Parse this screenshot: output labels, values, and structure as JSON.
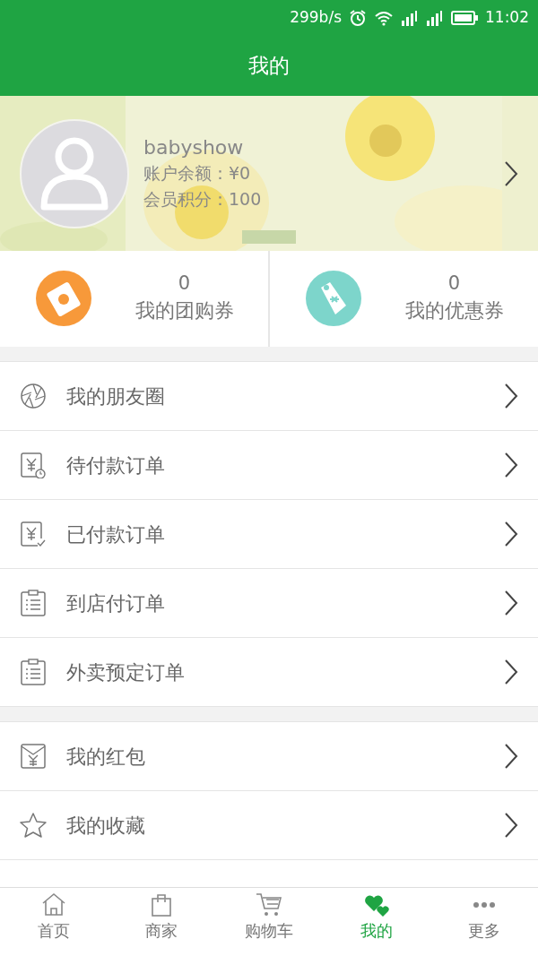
{
  "status_bar": {
    "speed": "299b/s",
    "time": "11:02"
  },
  "header": {
    "title": "我的"
  },
  "profile": {
    "username": "babyshow",
    "balance": "账户余额：¥0",
    "points": "会员积分：100"
  },
  "coupons": [
    {
      "kind": "group",
      "count": "0",
      "label": "我的团购券"
    },
    {
      "kind": "discount",
      "count": "0",
      "label": "我的优惠券"
    }
  ],
  "menu_groups": [
    [
      {
        "kind": "aperture",
        "label": "我的朋友圈"
      },
      {
        "kind": "pending",
        "label": "待付款订单"
      },
      {
        "kind": "paid",
        "label": "已付款订单"
      },
      {
        "kind": "list",
        "label": "到店付订单"
      },
      {
        "kind": "list",
        "label": "外卖预定订单"
      }
    ],
    [
      {
        "kind": "envelope",
        "label": "我的红包"
      },
      {
        "kind": "star",
        "label": "我的收藏"
      }
    ]
  ],
  "tab_bar": [
    {
      "kind": "home",
      "label": "首页",
      "selected": false
    },
    {
      "kind": "bag",
      "label": "商家",
      "selected": false
    },
    {
      "kind": "cart",
      "label": "购物车",
      "selected": false
    },
    {
      "kind": "hearts",
      "label": "我的",
      "selected": true
    },
    {
      "kind": "more",
      "label": "更多",
      "selected": false
    }
  ]
}
